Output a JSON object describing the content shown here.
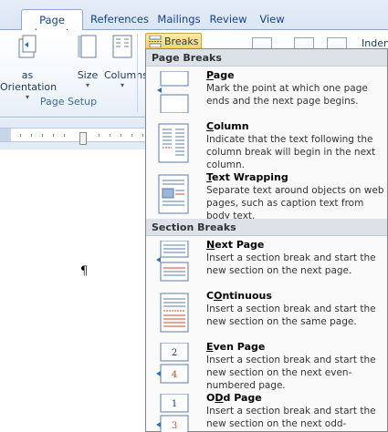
{
  "ribbon": {
    "tabs": [
      {
        "label": "Page Layout",
        "active": true
      },
      {
        "label": "References",
        "active": false
      },
      {
        "label": "Mailings",
        "active": false
      },
      {
        "label": "Review",
        "active": false
      },
      {
        "label": "View",
        "active": false
      }
    ],
    "buttons": {
      "orientation": "as Orientation",
      "size": "Size",
      "columns": "Columns",
      "breaks": "Breaks",
      "indent": "Indent"
    },
    "group_label": "Page Setup"
  },
  "menu": {
    "page_breaks_header": "Page Breaks",
    "section_breaks_header": "Section Breaks",
    "items": [
      {
        "key": "page",
        "accel": "P",
        "rest": "age",
        "desc": "Mark the point at which one page ends and the next page begins."
      },
      {
        "key": "column",
        "accel": "C",
        "rest": "olumn",
        "desc": "Indicate that the text following the column break will begin in the next column."
      },
      {
        "key": "text-wrapping",
        "accel": "T",
        "rest": "ext Wrapping",
        "desc": "Separate text around objects on web pages, such as caption text from body text."
      },
      {
        "key": "next-page",
        "accel": "N",
        "rest": "ext Page",
        "desc": "Insert a section break and start the new section on the next page."
      },
      {
        "key": "continuous",
        "accel": "O",
        "pre": "C",
        "rest": "ntinuous",
        "desc": "Insert a section break and start the new section on the same page."
      },
      {
        "key": "even-page",
        "accel": "E",
        "rest": "ven Page",
        "desc": "Insert a section break and start the new section on the next even-numbered page."
      },
      {
        "key": "odd-page",
        "accel": "D",
        "pre": "O",
        "rest": "d Page",
        "desc": "Insert a section break and start the new section on the next odd-numbered page."
      }
    ]
  },
  "document": {
    "paragraph_mark": "¶"
  },
  "colors": {
    "ribbon_text": "#15428b",
    "highlight": "#f9d46c",
    "section_header_bg": "#dde2e8"
  }
}
